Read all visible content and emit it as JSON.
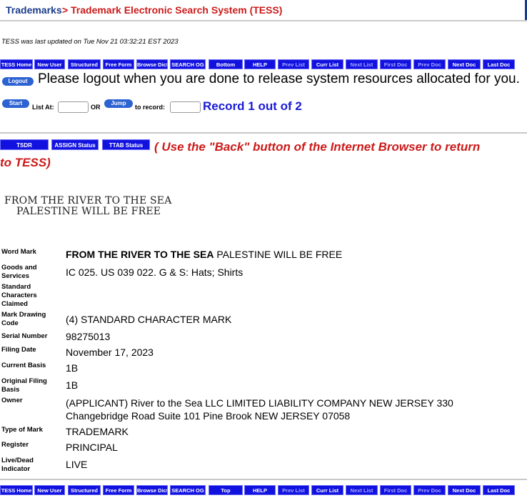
{
  "header": {
    "crumb1": "Trademarks",
    "separator": ">",
    "crumb2": "Trademark Electronic Search System (TESS)"
  },
  "updated_text": "TESS was last updated on Tue Nov 21 03:32:21 EST 2023",
  "nav_top": [
    "TESS Home",
    "New User",
    "Structured",
    "Free Form",
    "Browse Dict",
    "SEARCH OG",
    "Bottom",
    "HELP",
    "Prev List",
    "Curr List",
    "Next List",
    "First Doc",
    "Prev Doc",
    "Next Doc",
    "Last Doc"
  ],
  "nav_bottom": [
    "TESS Home",
    "New User",
    "Structured",
    "Free Form",
    "Browse Dict",
    "SEARCH OG",
    "Top",
    "HELP",
    "Prev List",
    "Curr List",
    "Next List",
    "First Doc",
    "Prev Doc",
    "Next Doc",
    "Last Doc"
  ],
  "logout": {
    "button": "Logout",
    "message": "Please logout when you are done to release system resources allocated for you."
  },
  "listing": {
    "start_button": "Start",
    "list_at_label": "List At:",
    "or_label": "OR",
    "jump_button": "Jump",
    "to_record_label": "to record:",
    "record_text": "Record 1 out of 2"
  },
  "status_buttons": {
    "tsdr": "TSDR",
    "assign": "ASSIGN Status",
    "ttab": "TTAB Status"
  },
  "back_message": {
    "line1": "( Use the \"Back\" button of the Internet Browser to return",
    "line2": "to TESS)"
  },
  "mark_image": {
    "line1": "FROM THE RIVER TO THE SEA",
    "line2": "PALESTINE WILL BE FREE"
  },
  "record": {
    "word_mark_label": "Word Mark",
    "word_mark_bold": "FROM THE RIVER TO THE SEA",
    "word_mark_rest": " PALESTINE WILL BE FREE",
    "goods_label": "Goods and Services",
    "goods_value": "IC 025. US 039 022. G & S: Hats; Shirts",
    "std_chars_label": "Standard Characters Claimed",
    "drawing_label": "Mark Drawing Code",
    "drawing_value": "(4) STANDARD CHARACTER MARK",
    "serial_label": "Serial Number",
    "serial_value": "98275013",
    "filing_label": "Filing Date",
    "filing_value": "November 17, 2023",
    "basis_label": "Current Basis",
    "basis_value": "1B",
    "orig_basis_label": "Original Filing Basis",
    "orig_basis_value": "1B",
    "owner_label": "Owner",
    "owner_value_line1": "(APPLICANT) River to the Sea LLC LIMITED LIABILITY COMPANY NEW JERSEY 330",
    "owner_value_line2": "Changebridge Road Suite 101 Pine Brook NEW JERSEY 07058",
    "type_label": "Type of Mark",
    "type_value": "TRADEMARK",
    "register_label": "Register",
    "register_value": "PRINCIPAL",
    "live_label": "Live/Dead Indicator",
    "live_value": "LIVE"
  }
}
